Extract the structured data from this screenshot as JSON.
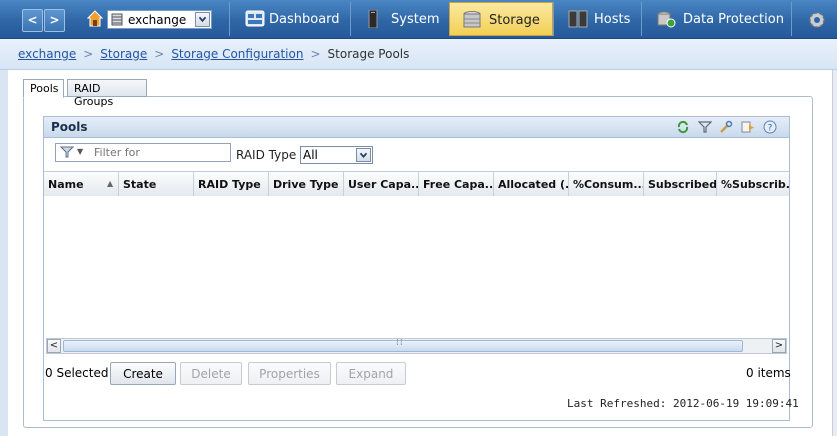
{
  "nav": {
    "back": "<",
    "forward": ">",
    "system_select": "exchange",
    "tabs": [
      {
        "label": "Dashboard",
        "icon": "dashboard-icon"
      },
      {
        "label": "System",
        "icon": "system-icon"
      },
      {
        "label": "Storage",
        "icon": "storage-icon",
        "active": true
      },
      {
        "label": "Hosts",
        "icon": "hosts-icon"
      },
      {
        "label": "Data Protection",
        "icon": "data-protection-icon"
      }
    ]
  },
  "breadcrumb": {
    "items": [
      "exchange",
      "Storage",
      "Storage Configuration"
    ],
    "current": "Storage Pools",
    "sep": ">"
  },
  "subtabs": [
    "Pools",
    "RAID Groups"
  ],
  "panel": {
    "title": "Pools",
    "filter_placeholder": "Filter for",
    "raid_label": "RAID Type",
    "raid_value": "All",
    "columns": [
      "Name",
      "State",
      "RAID Type",
      "Drive Type",
      "User Capa...",
      "Free Capa...",
      "Allocated (...",
      "%Consum...",
      "Subscribed...",
      "%Subscrib.."
    ],
    "selected": "0 Selected",
    "buttons": {
      "create": "Create",
      "delete": "Delete",
      "properties": "Properties",
      "expand": "Expand"
    },
    "items": "0 items",
    "last_refreshed": "Last Refreshed: 2012-06-19 19:09:41"
  },
  "colors": {
    "accent": "#2f67a6",
    "active_tab": "#f2cf55"
  }
}
